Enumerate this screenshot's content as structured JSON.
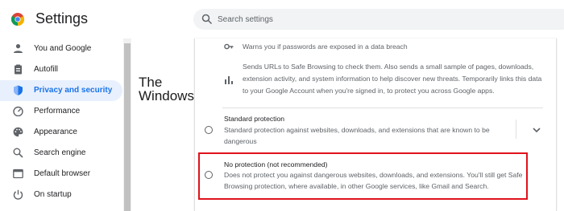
{
  "app": {
    "title": "Settings"
  },
  "search": {
    "placeholder": "Search settings"
  },
  "sidebar": {
    "items": [
      {
        "label": "You and Google",
        "icon": "person-icon"
      },
      {
        "label": "Autofill",
        "icon": "clipboard-icon"
      },
      {
        "label": "Privacy and security",
        "icon": "shield-icon",
        "active": true
      },
      {
        "label": "Performance",
        "icon": "speedometer-icon"
      },
      {
        "label": "Appearance",
        "icon": "palette-icon"
      },
      {
        "label": "Search engine",
        "icon": "search-icon"
      },
      {
        "label": "Default browser",
        "icon": "browser-window-icon"
      },
      {
        "label": "On startup",
        "icon": "power-icon"
      }
    ]
  },
  "watermark": {
    "line1": "The",
    "line2": "WindowsClub"
  },
  "content": {
    "password_breach": {
      "text": "Warns you if passwords are exposed in a data breach",
      "icon": "key-icon"
    },
    "safe_browsing_data": {
      "icon": "bar-chart-icon",
      "lines": [
        "Sends URLs to Safe Browsing to check them. Also sends a small sample of pages, downloads,",
        "extension activity, and system information to help discover new threats. Temporarily links this data",
        "to your Google Account when you're signed in, to protect you across Google apps."
      ]
    },
    "standard_protection": {
      "title": "Standard protection",
      "lines": [
        "Standard protection against websites, downloads, and extensions that are known to be",
        "dangerous"
      ]
    },
    "no_protection": {
      "title": "No protection (not recommended)",
      "lines": [
        "Does not protect you against dangerous websites, downloads, and extensions. You'll still get Safe",
        "Browsing protection, where available, in other Google services, like Gmail and Search."
      ]
    }
  },
  "colors": {
    "accent": "#1a73e8",
    "active_bg": "#e8f0fe",
    "highlight": "#e0121c"
  }
}
